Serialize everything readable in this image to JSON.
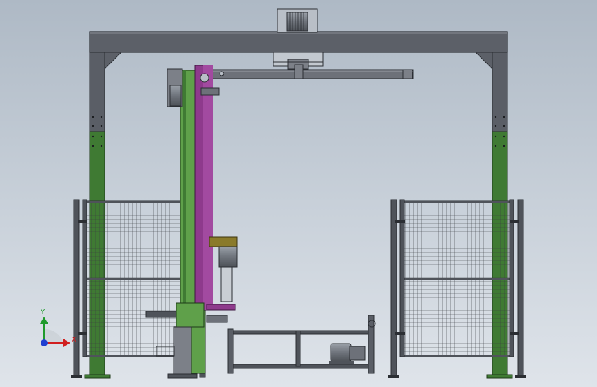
{
  "view": {
    "background_top": "#aeb9c5",
    "background_bottom": "#dfe4ea"
  },
  "colors": {
    "frame_gray": "#5a5e66",
    "frame_dark": "#2b2e33",
    "post_green": "#3f7a33",
    "mast_green": "#5fa04a",
    "mast_magenta": "#8e3a8c",
    "arm_gray": "#6d7179",
    "fence_post": "#4f535a",
    "mesh": "#3a3d42",
    "motor_gray": "#7c8088",
    "gear_olive": "#8a7a2a",
    "axis_x": "#d11f1f",
    "axis_y": "#1f9a2b",
    "axis_z": "#1f3fd1"
  },
  "triad": {
    "x_label": "X",
    "y_label": "Y"
  },
  "icons": {
    "triad": "coordinate-triad-icon"
  }
}
